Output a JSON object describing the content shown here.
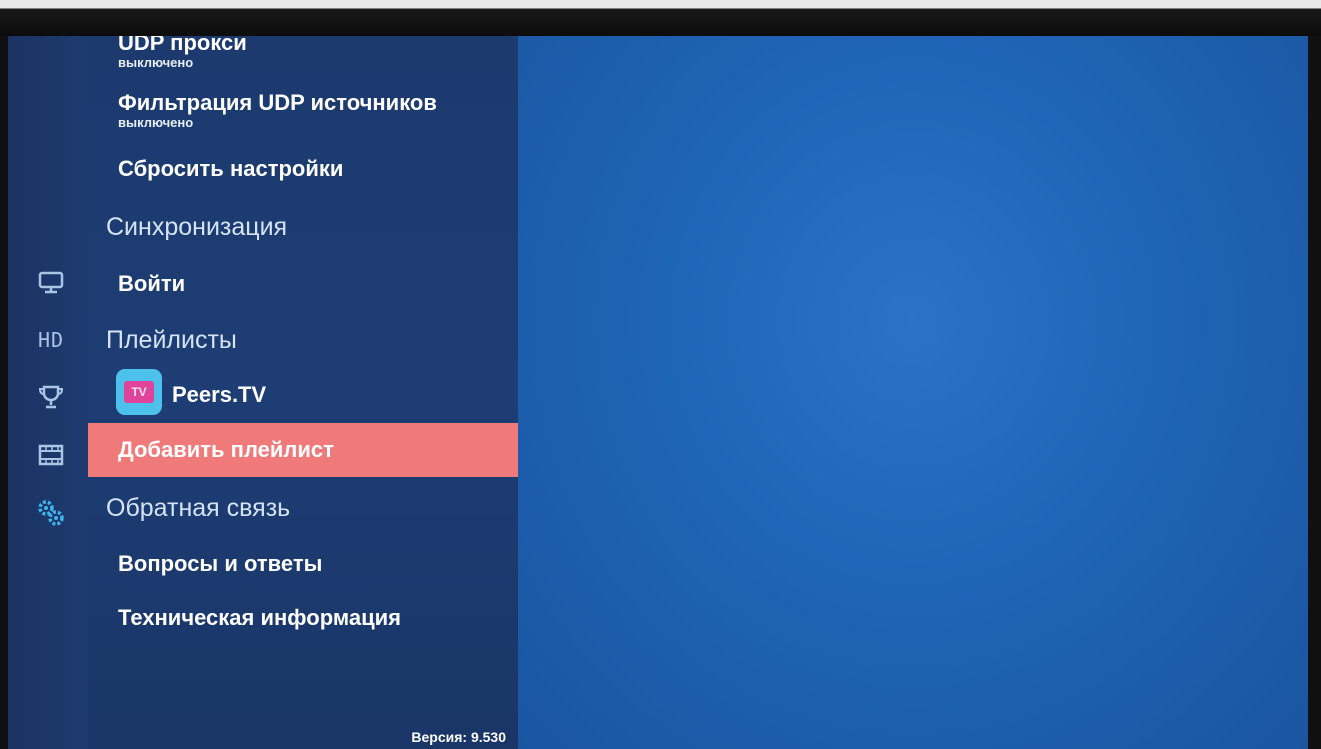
{
  "menu": {
    "udp_proxy": {
      "title": "UDP прокси",
      "value": "выключено"
    },
    "udp_filter": {
      "title": "Фильтрация UDP источников",
      "value": "выключено"
    },
    "reset": "Сбросить настройки",
    "sync_header": "Синхронизация",
    "login": "Войти",
    "playlists_header": "Плейлисты",
    "playlist_name": "Peers.TV",
    "playlist_logo_text": "TV",
    "add_playlist": "Добавить плейлист",
    "feedback_header": "Обратная связь",
    "faq": "Вопросы и ответы",
    "tech_info": "Техническая информация",
    "version": "Версия: 9.530"
  },
  "rail": {
    "hd_label": "HD",
    "icons": [
      "tv-icon",
      "hd-icon",
      "trophy-icon",
      "film-icon",
      "settings-icon"
    ]
  },
  "colors": {
    "selected_bg": "#f07a7a",
    "panel_bg": "#1c3a6e",
    "content_bg": "#1f65b6",
    "logo_blue": "#4ec0ec",
    "logo_pink": "#e0449a"
  }
}
